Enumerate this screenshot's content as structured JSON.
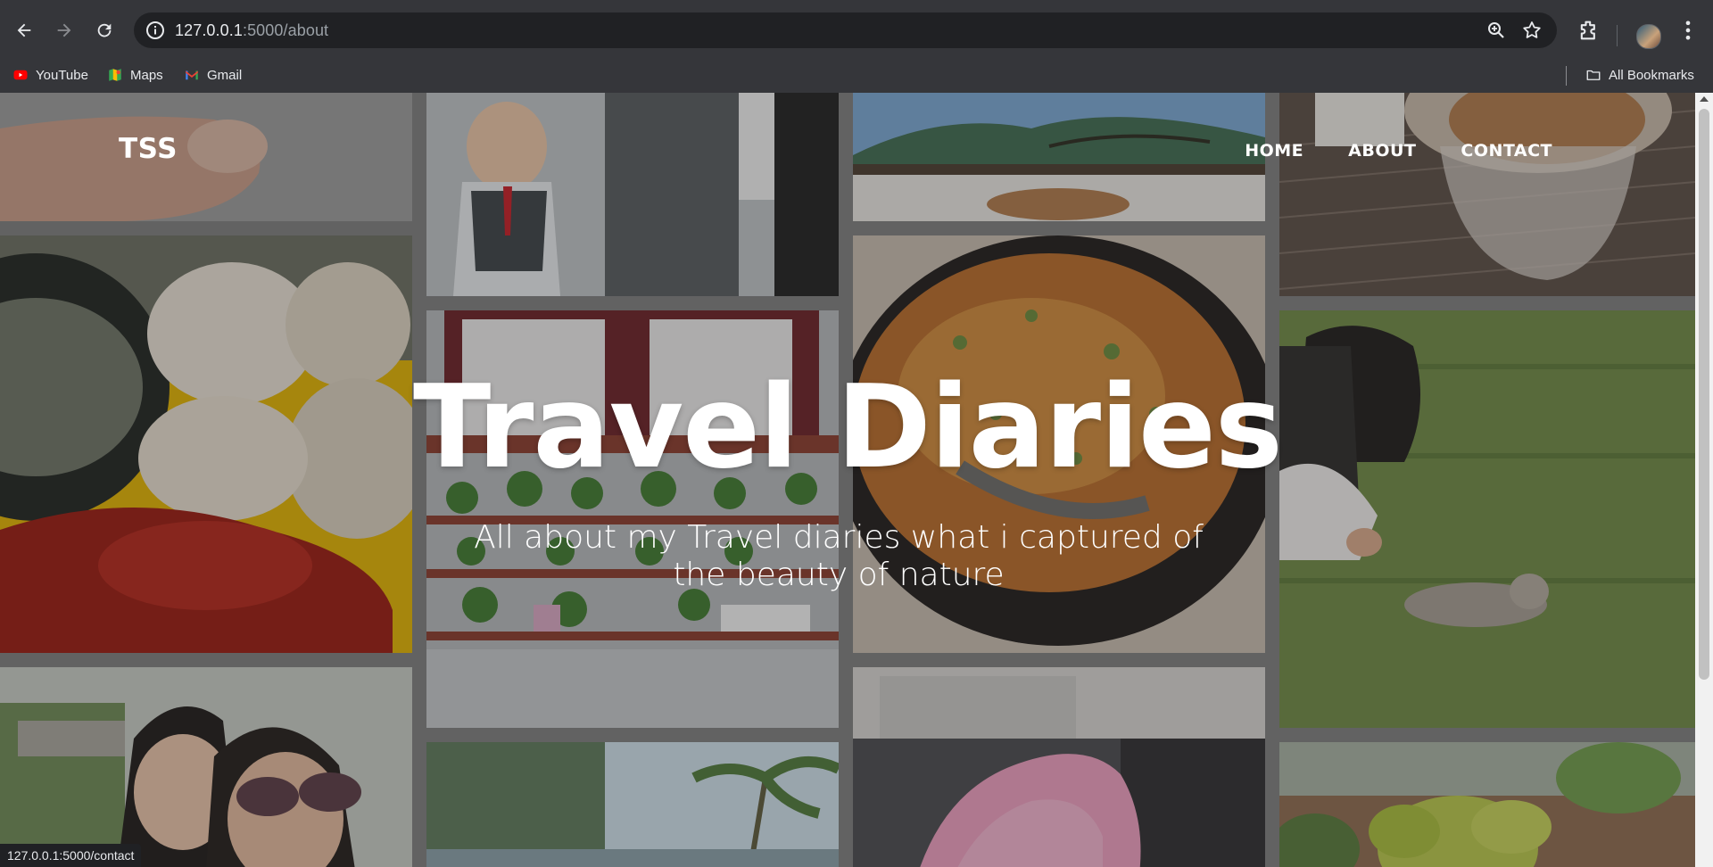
{
  "browser": {
    "url_host": "127.0.0.1",
    "url_path": ":5000/about",
    "bookmarks": [
      {
        "label": "YouTube",
        "icon": "youtube-icon"
      },
      {
        "label": "Maps",
        "icon": "maps-icon"
      },
      {
        "label": "Gmail",
        "icon": "gmail-icon"
      }
    ],
    "all_bookmarks": "All Bookmarks",
    "status_url": "127.0.0.1:5000/contact"
  },
  "site": {
    "logo": "TSS",
    "menu": [
      "HOME",
      "ABOUT",
      "CONTACT"
    ],
    "hero_title": "Travel Diaries",
    "hero_subtitle": "All about my Travel diaries what i captured of the beauty of nature"
  },
  "gallery": {
    "photos": [
      {
        "desc": "hand-close-up",
        "color": "#b58e7b"
      },
      {
        "desc": "boy-in-vest",
        "color": "#7a756c"
      },
      {
        "desc": "mountain-painting",
        "color": "#6d87a8"
      },
      {
        "desc": "coffee-glass",
        "color": "#8d7462"
      },
      {
        "desc": "momos-with-sauce",
        "color": "#b69a78"
      },
      {
        "desc": "plant-shelves",
        "color": "#8c7665"
      },
      {
        "desc": "curry-bowl",
        "color": "#8a5a2f"
      },
      {
        "desc": "girl-with-cat",
        "color": "#5e7440"
      },
      {
        "desc": "selfie-two-girls",
        "color": "#8a8479"
      },
      {
        "desc": "palm-trees",
        "color": "#7f9aa7"
      },
      {
        "desc": "pink-dessert",
        "color": "#8f7b84"
      },
      {
        "desc": "succulent",
        "color": "#6f7e52"
      }
    ]
  },
  "colors": {
    "chrome_bg": "#35363a",
    "omnibox_bg": "#202124",
    "gallery_gap": "#7e7e7e"
  }
}
